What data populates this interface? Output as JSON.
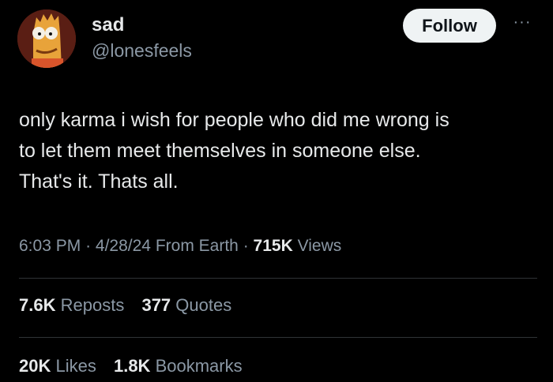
{
  "user": {
    "display_name": "sad",
    "handle": "@lonesfeels",
    "avatar_icon": "cartoon-avatar-icon"
  },
  "header": {
    "follow_label": "Follow",
    "more_icon": "more-icon"
  },
  "tweet": {
    "lines": [
      "only karma i wish for people who did me wrong is",
      "to let them meet themselves in someone else.",
      "That's it. Thats all."
    ]
  },
  "meta": {
    "time": "6:03 PM",
    "separator": "·",
    "date": "4/28/24",
    "source": "From Earth",
    "views_count": "715K",
    "views_label": "Views"
  },
  "stats": {
    "reposts_count": "7.6K",
    "reposts_label": "Reposts",
    "quotes_count": "377",
    "quotes_label": "Quotes",
    "likes_count": "20K",
    "likes_label": "Likes",
    "bookmarks_count": "1.8K",
    "bookmarks_label": "Bookmarks"
  },
  "colors": {
    "background": "#000000",
    "text_primary": "#e7e9ea",
    "text_secondary": "#8b98a5",
    "divider": "#2f3336",
    "follow_bg": "#eff3f4"
  }
}
